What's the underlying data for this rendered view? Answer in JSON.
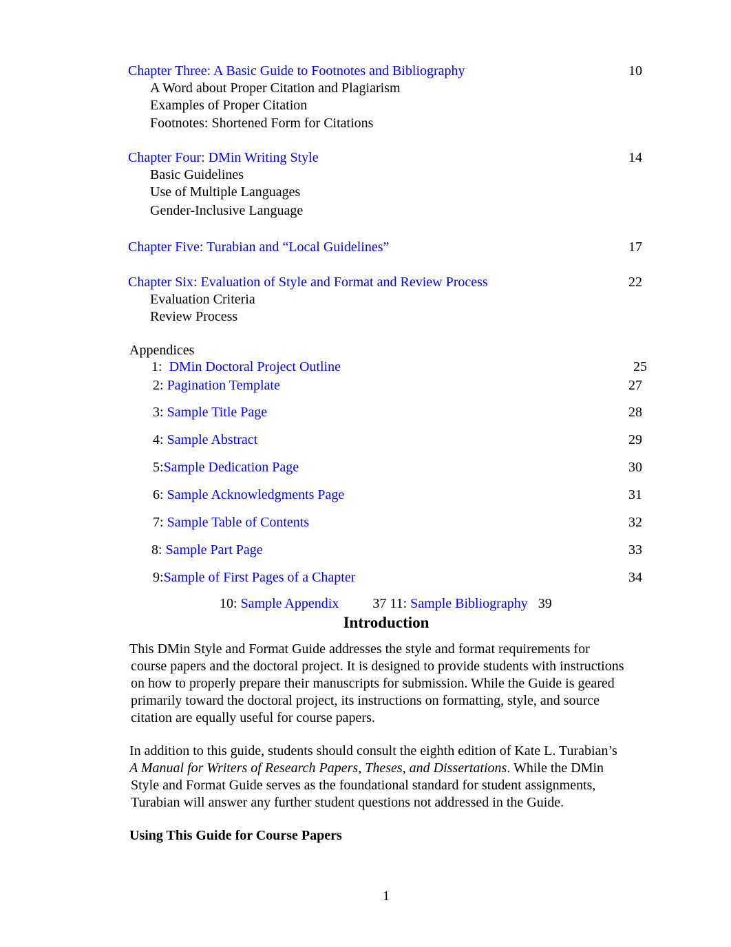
{
  "toc": {
    "chapters": [
      {
        "title": "Chapter Three: A Basic Guide to Footnotes and Bibliography",
        "page": "10",
        "subsections": [
          "A Word about Proper Citation and Plagiarism",
          "Examples of Proper Citation",
          "Footnotes: Shortened Form for Citations"
        ]
      },
      {
        "title": "Chapter Four: DMin Writing Style",
        "page": "14",
        "subsections": [
          "Basic Guidelines",
          "Use of Multiple Languages",
          "Gender-Inclusive Language"
        ]
      },
      {
        "title": "Chapter Five: Turabian and “Local Guidelines”",
        "page": "17",
        "subsections": []
      },
      {
        "title": "Chapter Six: Evaluation of Style and Format and Review Process",
        "page": "22",
        "subsections": [
          "Evaluation Criteria",
          "Review Process"
        ]
      }
    ],
    "appendices_label": "Appendices",
    "appendices": [
      {
        "num": "1:",
        "title": "DMin Doctoral Project Outline",
        "page": "25"
      },
      {
        "num": "2:",
        "title": "Pagination Template",
        "page": "27"
      },
      {
        "num": "3:",
        "title": "Sample Title Page",
        "page": "28"
      },
      {
        "num": "4:",
        "title": "Sample Abstract",
        "page": "29"
      },
      {
        "num": "5:",
        "title": "Sample Dedication Page",
        "page": "30"
      },
      {
        "num": "6:",
        "title": "Sample Acknowledgments Page",
        "page": "31"
      },
      {
        "num": "7:",
        "title": "Sample Table of Contents",
        "page": "32"
      },
      {
        "num": "8:",
        "title": "Sample Part Page",
        "page": "33"
      },
      {
        "num": "9:",
        "title": "Sample of First Pages of a Chapter",
        "page": "34"
      }
    ],
    "last_line": {
      "num10": "10:",
      "title10": "Sample Appendix",
      "mid": "37 11:",
      "title11": "Sample Bibliography",
      "page11": "39"
    }
  },
  "introduction": {
    "heading": "Introduction",
    "paragraph1": [
      "This DMin Style and Format Guide addresses the style and format requirements for",
      "course papers and the doctoral project. It is designed to provide students with instructions",
      "on how to properly prepare their manuscripts for submission. While the Guide is geared",
      "primarily toward the doctoral project, its instructions on formatting, style, and source",
      "citation are equally useful for course papers."
    ],
    "paragraph2": {
      "line1": "In addition to this guide, students should consult the eighth edition of Kate L. Turabian’s",
      "italic_title": "A Manual for Writers of Research Papers, Theses, and Dissertations",
      "line2_rest": ". While the DMin",
      "line3": "Style and Format Guide serves as the foundational standard for student assignments,",
      "line4": "Turabian will answer any further student questions not addressed in the Guide."
    },
    "subheading": "Using This Guide for Course Papers"
  },
  "page_number": "1"
}
